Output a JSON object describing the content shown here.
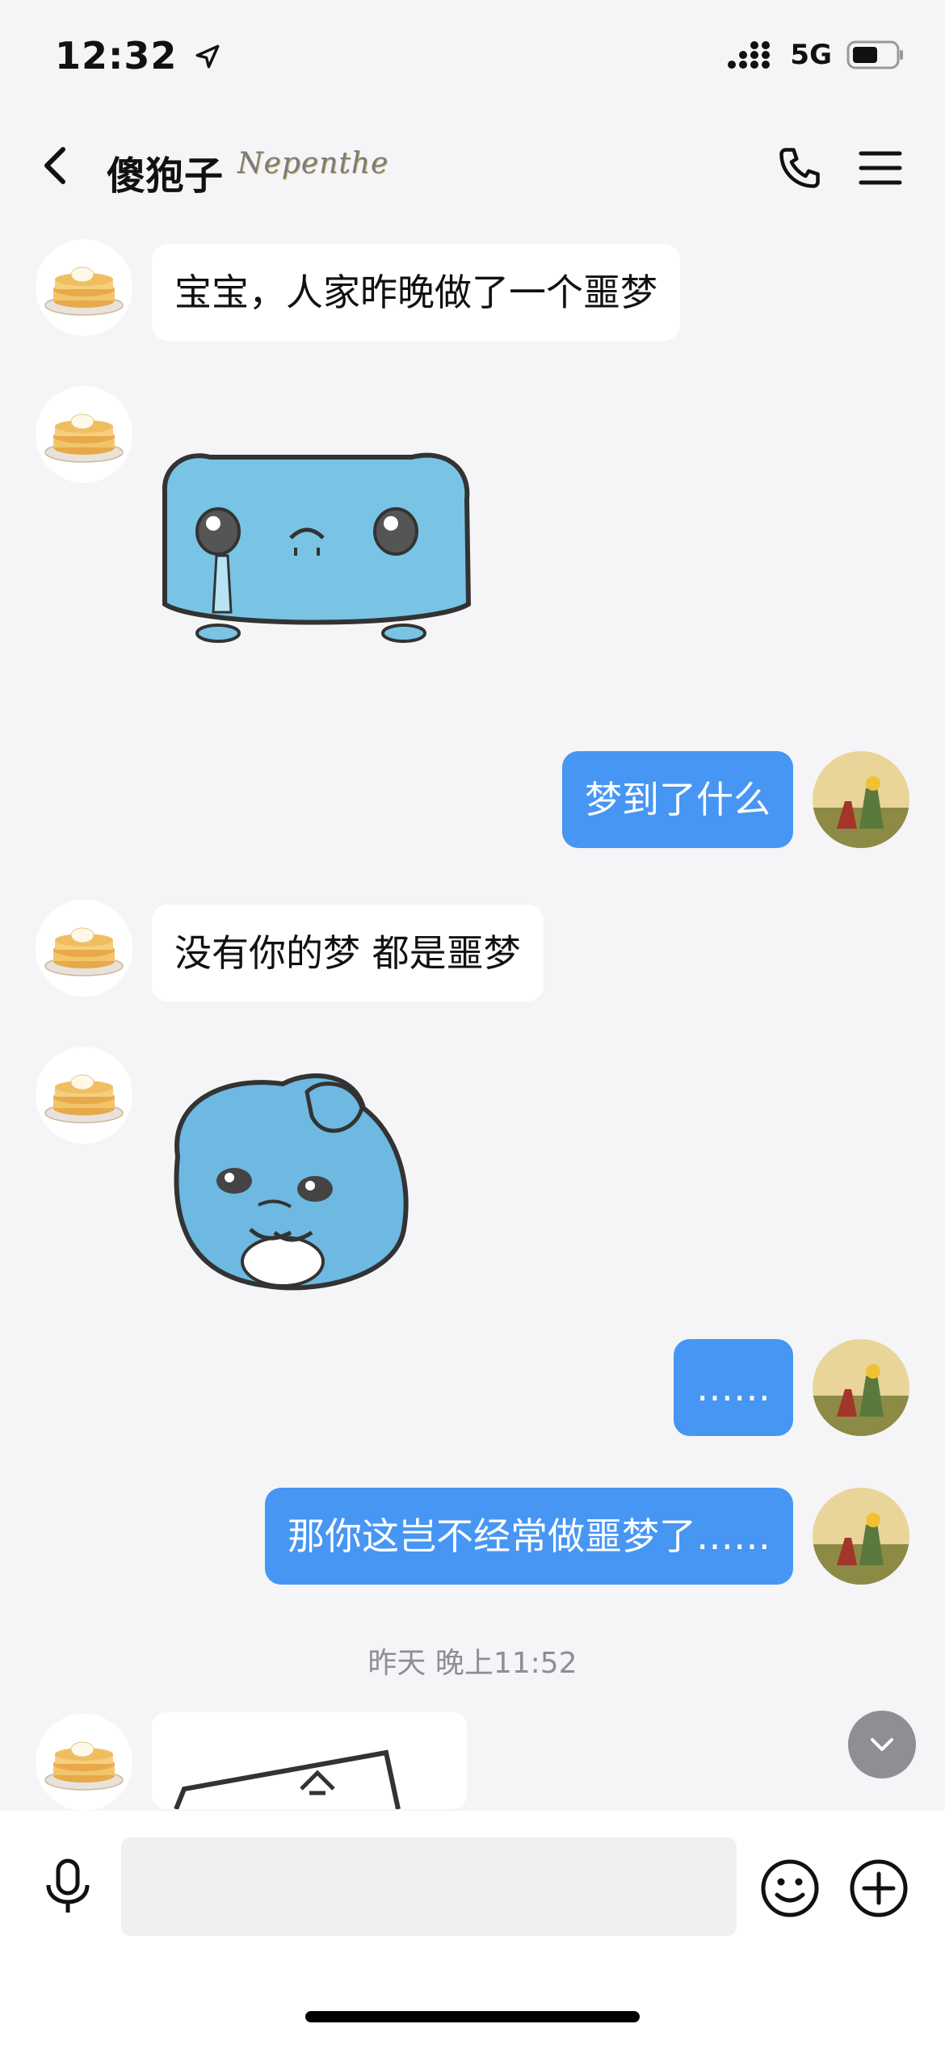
{
  "status_bar": {
    "time": "12:32",
    "network": "5G"
  },
  "header": {
    "title": "傻狍子",
    "badge": "Nepenthe"
  },
  "messages": [
    {
      "side": "in",
      "type": "text",
      "text": "宝宝，人家昨晚做了一个噩梦"
    },
    {
      "side": "in",
      "type": "sticker",
      "sticker": "crying-blue-creature-sticker"
    },
    {
      "side": "out",
      "type": "text",
      "text": "梦到了什么"
    },
    {
      "side": "in",
      "type": "text",
      "text": "没有你的梦 都是噩梦"
    },
    {
      "side": "in",
      "type": "sticker",
      "sticker": "sad-blue-creature-sticker"
    },
    {
      "side": "out",
      "type": "text",
      "text": "……"
    },
    {
      "side": "out",
      "type": "text",
      "text": "那你这岂不经常做噩梦了……"
    },
    {
      "side": "in",
      "type": "image",
      "image": "partial-image"
    }
  ],
  "timestamp": "昨天 晚上11:52",
  "input": {
    "placeholder": ""
  },
  "colors": {
    "outgoing_bubble": "#4796f4",
    "incoming_bubble": "#ffffff",
    "background": "#f5f5f7"
  }
}
